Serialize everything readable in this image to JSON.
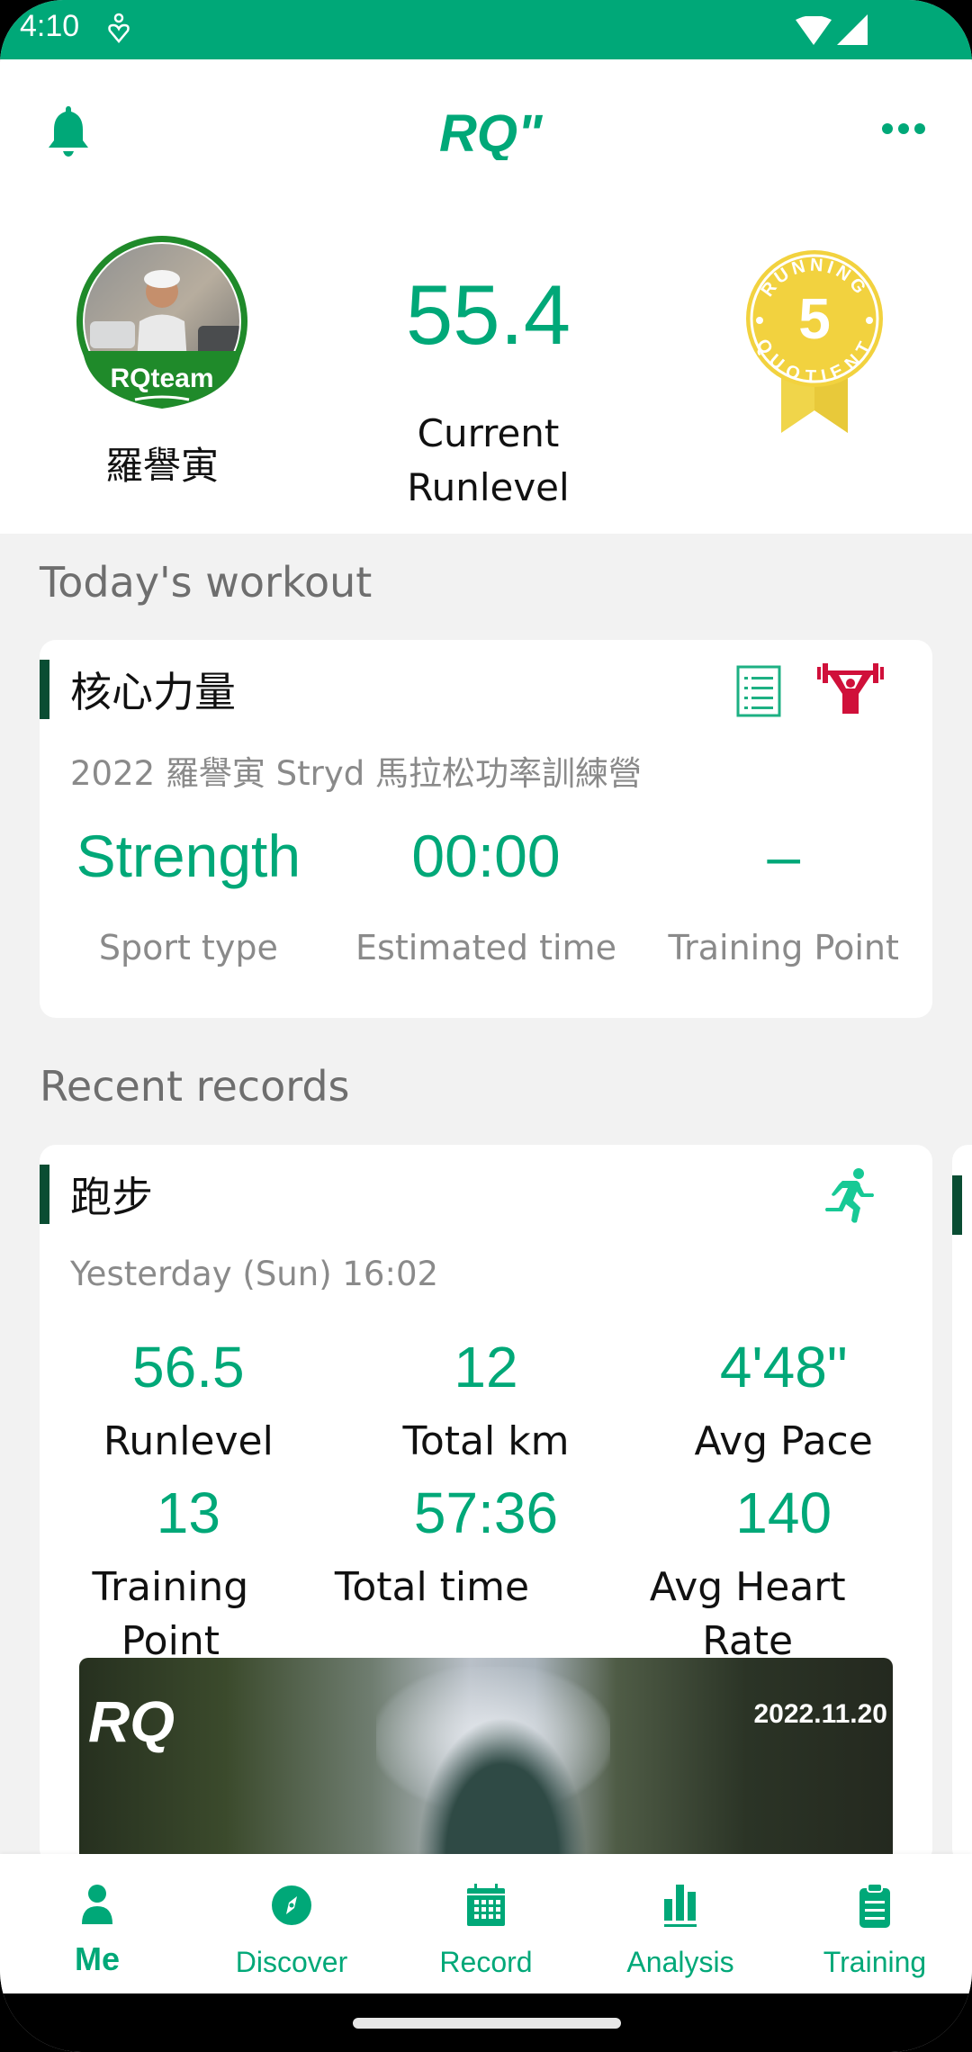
{
  "status_bar": {
    "time": "4:10",
    "icons": [
      "accessibility-person-icon",
      "wifi-icon",
      "signal-icon"
    ]
  },
  "header": {
    "logo_text": "RQ\"",
    "left_icon": "bell-icon",
    "right_icon": "more-dots-icon"
  },
  "profile": {
    "avatar_badge_text": "RQteam",
    "name": "羅譽寅",
    "runlevel_value": "55.4",
    "runlevel_label": "Current Runlevel",
    "badge": {
      "number": "5",
      "top_text": "RUNNING",
      "bottom_text": "QUOTIENT"
    }
  },
  "todays_workout": {
    "section_title": "Today's workout",
    "card": {
      "title": "核心力量",
      "subtitle": "2022 羅譽寅 Stryd 馬拉松功率訓練營",
      "icons": [
        "list-icon",
        "weightlifting-icon"
      ],
      "stats": [
        {
          "value": "Strength",
          "label": "Sport type"
        },
        {
          "value": "00:00",
          "label": "Estimated time"
        },
        {
          "value": "–",
          "label": "Training Point"
        }
      ]
    }
  },
  "recent_records": {
    "section_title": "Recent records",
    "cards": [
      {
        "title": "跑步",
        "icon": "running-icon",
        "datetime": "Yesterday (Sun) 16:02",
        "stats": [
          {
            "value": "56.5",
            "label": "Runlevel"
          },
          {
            "value": "12",
            "label": "Total km"
          },
          {
            "value": "4'48\"",
            "label": "Avg Pace"
          },
          {
            "value": "13",
            "label": "Training Point"
          },
          {
            "value": "57:36",
            "label": "Total time"
          },
          {
            "value": "140",
            "label": "Avg Heart Rate"
          }
        ],
        "photo": {
          "logo": "RQ",
          "date": "2022.11.20"
        }
      }
    ]
  },
  "bottom_nav": {
    "items": [
      {
        "label": "Me",
        "icon": "person-icon",
        "active": true
      },
      {
        "label": "Discover",
        "icon": "compass-icon",
        "active": false
      },
      {
        "label": "Record",
        "icon": "calendar-icon",
        "active": false
      },
      {
        "label": "Analysis",
        "icon": "bar-chart-icon",
        "active": false
      },
      {
        "label": "Training",
        "icon": "clipboard-icon",
        "active": false
      }
    ]
  },
  "colors": {
    "brand_green": "#00a878",
    "accent_dark_green": "#0a4d33",
    "strength_icon_red": "#d0103a",
    "badge_yellow": "#f2d23f",
    "avatar_ring_green": "#1f8a2a"
  }
}
